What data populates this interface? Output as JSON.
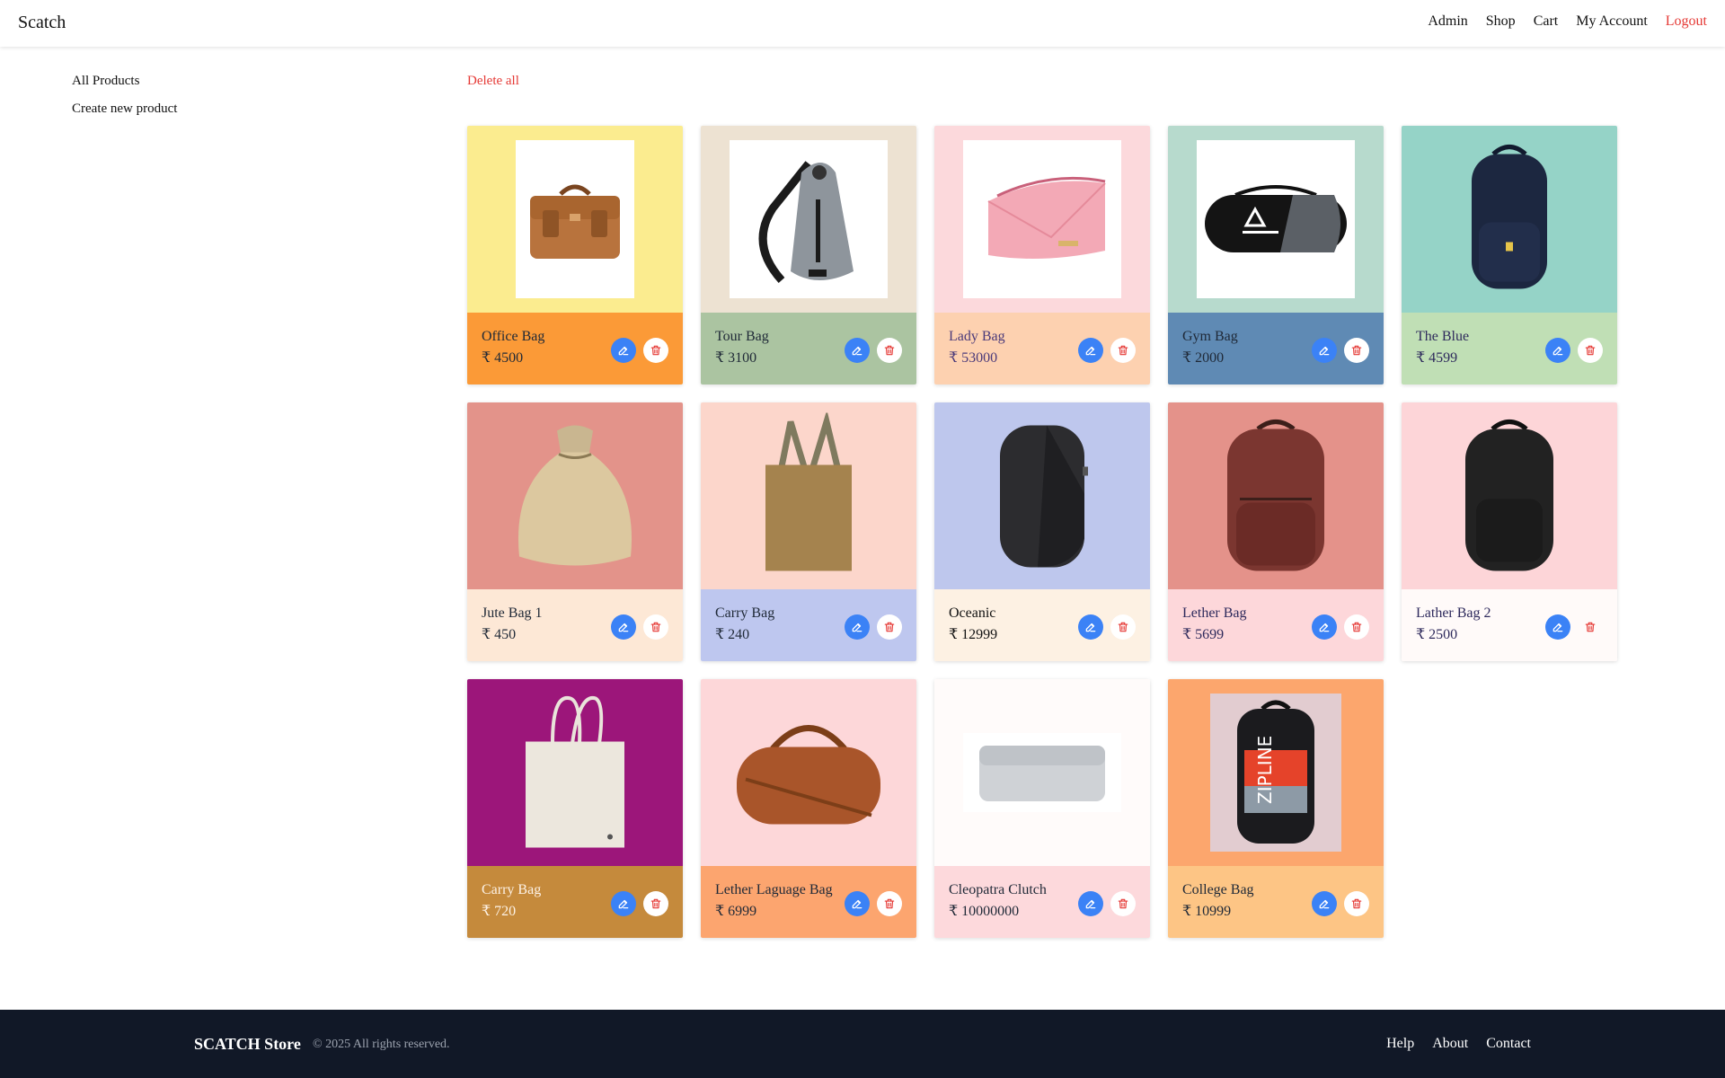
{
  "nav": {
    "brand": "Scatch",
    "links": [
      "Admin",
      "Shop",
      "Cart",
      "My Account"
    ],
    "logout": "Logout"
  },
  "sidebar": {
    "items": [
      "All Products",
      "Create new product"
    ]
  },
  "main": {
    "delete_all": "Delete all"
  },
  "products": [
    {
      "name": "Office Bag",
      "price": "₹ 4500",
      "bg": "#fbec8f",
      "panel": "#fb9a37",
      "text": "#1f2937",
      "img": "office-bag",
      "img_icon": "briefcase-icon"
    },
    {
      "name": "Tour Bag",
      "price": "₹ 3100",
      "bg": "#ede2d2",
      "panel": "#abc4a1",
      "text": "#1f2937",
      "img": "tour-bag",
      "img_icon": "sling-bag-icon"
    },
    {
      "name": "Lady Bag",
      "price": "₹ 53000",
      "bg": "#fcd9dc",
      "panel": "#fdd1b0",
      "text": "#4b3a7a",
      "img": "lady-bag",
      "img_icon": "pouch-icon"
    },
    {
      "name": "Gym Bag",
      "price": "₹ 2000",
      "bg": "#b7dacd",
      "panel": "#5f8ab4",
      "text": "#1f2937",
      "img": "gym-bag",
      "img_icon": "duffel-icon"
    },
    {
      "name": "The Blue",
      "price": "₹ 4599",
      "bg": "#95d3c7",
      "panel": "#c0dfb5",
      "text": "#2e2a5c",
      "img": "blue-backpack",
      "img_icon": "backpack-icon"
    },
    {
      "name": "Jute Bag 1",
      "price": "₹ 450",
      "bg": "#e3938a",
      "panel": "#fde8d6",
      "text": "#1f2937",
      "img": "jute-bag",
      "img_icon": "sack-icon"
    },
    {
      "name": "Carry Bag",
      "price": "₹ 240",
      "bg": "#fcd6cb",
      "panel": "#bec7ef",
      "text": "#1f2937",
      "img": "tote-brown",
      "img_icon": "tote-icon"
    },
    {
      "name": "Oceanic",
      "price": "₹ 12999",
      "bg": "#bec7ed",
      "panel": "#fdf1e3",
      "text": "#111",
      "img": "oceanic",
      "img_icon": "backpack-icon"
    },
    {
      "name": "Lether Bag",
      "price": "₹ 5699",
      "bg": "#e4928a",
      "panel": "#fdd7da",
      "text": "#2e2a5c",
      "img": "leather-backpack",
      "img_icon": "backpack-icon"
    },
    {
      "name": "Lather Bag 2",
      "price": "₹ 2500",
      "bg": "#fdd5d8",
      "panel": "#fffaf9",
      "text": "#2e2a5c",
      "img": "black-backpack",
      "img_icon": "backpack-icon"
    },
    {
      "name": "Carry Bag",
      "price": "₹ 720",
      "bg": "#9c167a",
      "panel": "#c58a3c",
      "text": "#fdf2e6",
      "img": "tote-white",
      "img_icon": "tote-icon"
    },
    {
      "name": "Lether Laguage Bag",
      "price": "₹ 6999",
      "bg": "#fdd7d9",
      "panel": "#fca56f",
      "text": "#1f2937",
      "img": "duffel-brown",
      "img_icon": "duffel-icon"
    },
    {
      "name": "Cleopatra Clutch",
      "price": "₹ 10000000",
      "bg": "#fffbfa",
      "panel": "#fdd9dc",
      "text": "#1f2937",
      "img": "clutch",
      "img_icon": "clutch-icon"
    },
    {
      "name": "College Bag",
      "price": "₹ 10999",
      "bg": "#fca66d",
      "panel": "#fdc585",
      "text": "#1f2937",
      "img": "college-bag",
      "img_icon": "backpack-icon"
    }
  ],
  "footer": {
    "brand": "SCATCH Store",
    "copyright": "© 2025 All rights reserved.",
    "links": [
      "Help",
      "About",
      "Contact"
    ]
  }
}
